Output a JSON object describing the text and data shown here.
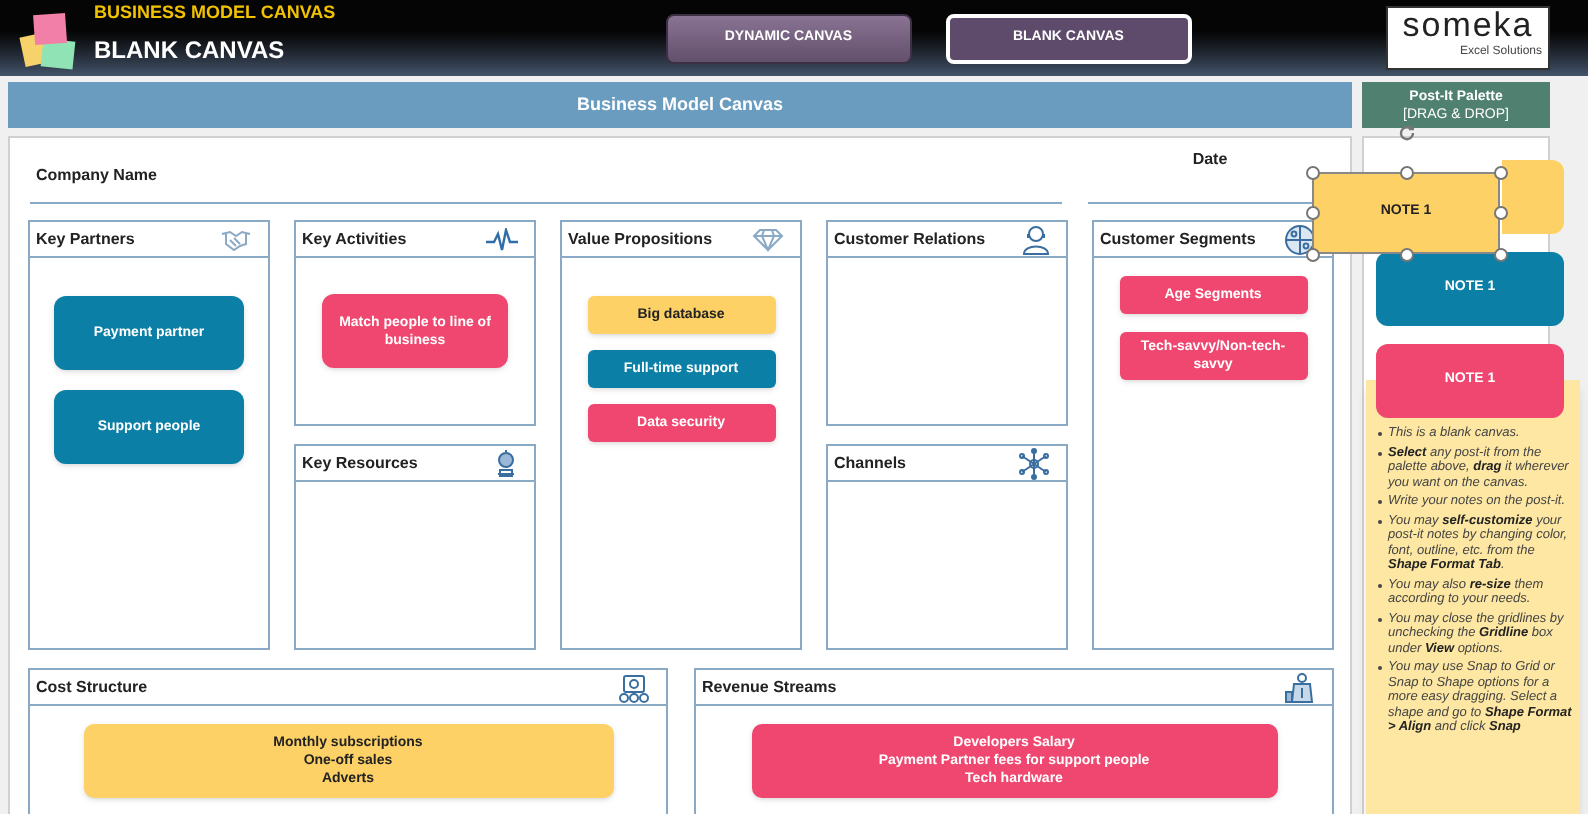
{
  "header": {
    "subtitle": "BUSINESS MODEL CANVAS",
    "title": "BLANK CANVAS"
  },
  "nav_buttons": [
    {
      "label": "DYNAMIC CANVAS",
      "selected": false
    },
    {
      "label": "BLANK CANVAS",
      "selected": true
    }
  ],
  "logo": {
    "name": "someka",
    "tagline": "Excel Solutions"
  },
  "banner": "Business Model Canvas",
  "palette_header": {
    "title": "Post-It Palette",
    "subtitle": "[DRAG & DROP]"
  },
  "canvas": {
    "company_label": "Company Name",
    "date_label": "Date",
    "blocks": [
      {
        "title": "Key Partners",
        "notes": [
          {
            "text": "Payment partner",
            "color": "#0b7fa6"
          },
          {
            "text": "Support people",
            "color": "#0b7fa6"
          }
        ]
      },
      {
        "title": "Key Activities",
        "notes": [
          {
            "text": "Match people to  line of business",
            "color": "#ef476f"
          }
        ]
      },
      {
        "title": "Key Resources"
      },
      {
        "title": "Value Propositions",
        "notes": [
          {
            "text": "Big database",
            "color": "#fdd166"
          },
          {
            "text": "Full-time support",
            "color": "#0b7fa6"
          },
          {
            "text": "Data security",
            "color": "#ef476f"
          }
        ]
      },
      {
        "title": "Customer Relations"
      },
      {
        "title": "Channels"
      },
      {
        "title": "Customer Segments",
        "notes": [
          {
            "text": "Age Segments",
            "color": "#ef476f"
          },
          {
            "text": "Tech-savvy/Non-tech-savvy",
            "color": "#ef476f"
          }
        ]
      },
      {
        "title": "Cost Structure",
        "notes": [
          {
            "text": "Monthly subscriptions\nOne-off sales\nAdverts",
            "color": "#fdd166"
          }
        ]
      },
      {
        "title": "Revenue Streams",
        "notes": [
          {
            "text": "Developers Salary\nPayment Partner fees for support people\nTech hardware",
            "color": "#ef476f"
          }
        ]
      }
    ]
  },
  "palette_notes": [
    {
      "color": "#fdd166"
    },
    {
      "text": "NOTE 1",
      "color": "#0b7fa6"
    },
    {
      "text": "NOTE 1",
      "color": "#ef476f"
    }
  ],
  "dragged_note": {
    "text": "NOTE 1",
    "color": "#fdd166",
    "selected": true
  },
  "instructions": [
    "This is a blank canvas.",
    "**Select** any post-it from the palette above, **drag** it wherever you want on the canvas.",
    "Write your notes on the post-it.",
    "You may **self-customize** your post-it notes by changing color, font, outline, etc. from the **Shape Format Tab**.",
    "You may also **re-size** them according to your needs.",
    "You may close the  gridlines by unchecking the **Gridline** box under **View** options.",
    "You may use Snap to Grid or Snap to Shape options for a more easy dragging. Select a shape and go to **Shape Format > Align** and click **Snap**"
  ]
}
